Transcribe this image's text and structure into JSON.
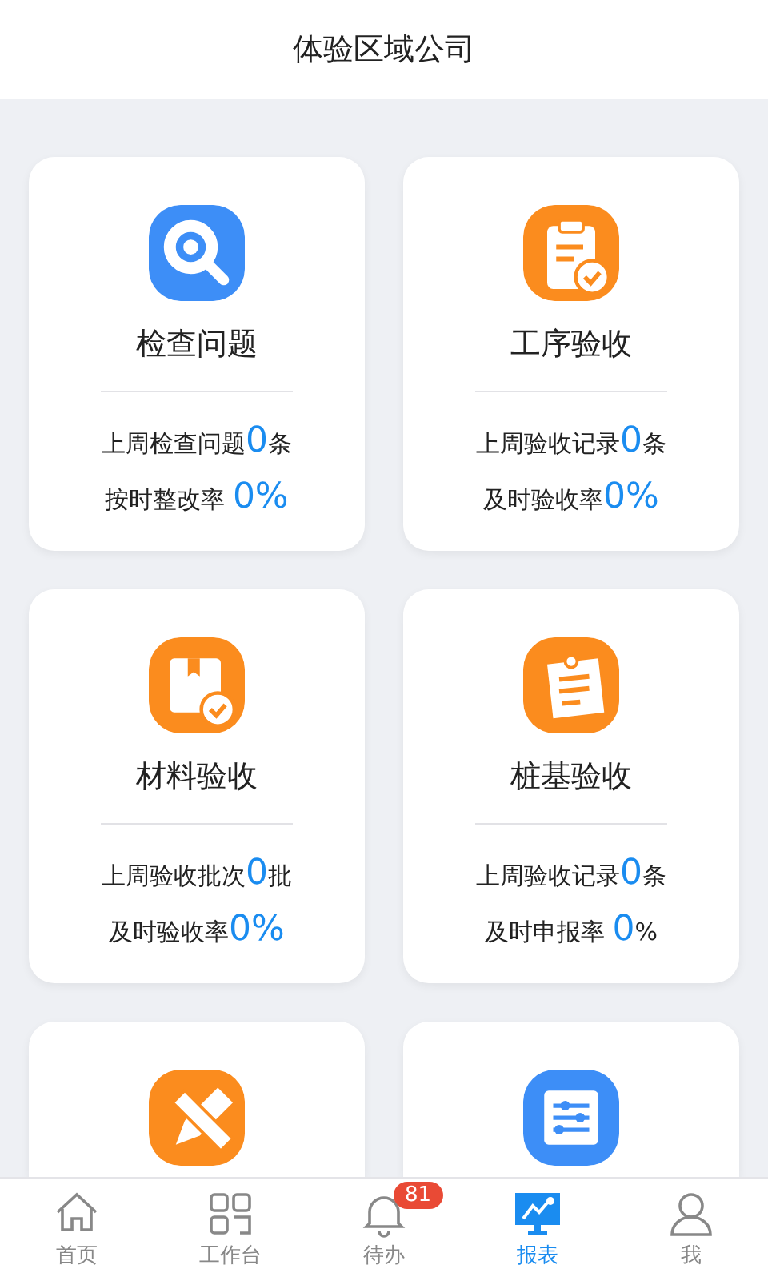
{
  "header": {
    "title": "体验区域公司"
  },
  "cards": [
    {
      "title": "检查问题",
      "kind": "search",
      "color": "#3d8ef7",
      "stats": [
        [
          {
            "kind": "label",
            "text": "上周检查问题"
          },
          {
            "kind": "number",
            "text": "0"
          },
          {
            "kind": "label",
            "text": "条"
          }
        ],
        [
          {
            "kind": "label",
            "text": "按时整改率 "
          },
          {
            "kind": "number",
            "text": "0%"
          }
        ]
      ]
    },
    {
      "title": "工序验收",
      "kind": "clipboard",
      "color": "#fb8c1e",
      "stats": [
        [
          {
            "kind": "label",
            "text": "上周验收记录"
          },
          {
            "kind": "number",
            "text": "0"
          },
          {
            "kind": "label",
            "text": "条"
          }
        ],
        [
          {
            "kind": "label",
            "text": "及时验收率"
          },
          {
            "kind": "number",
            "text": "0%"
          }
        ]
      ]
    },
    {
      "title": "材料验收",
      "kind": "package",
      "color": "#fb8c1e",
      "stats": [
        [
          {
            "kind": "label",
            "text": "上周验收批次"
          },
          {
            "kind": "number",
            "text": "0"
          },
          {
            "kind": "label",
            "text": "批"
          }
        ],
        [
          {
            "kind": "label",
            "text": "及时验收率"
          },
          {
            "kind": "number",
            "text": "0%"
          }
        ]
      ]
    },
    {
      "title": "桩基验收",
      "kind": "note",
      "color": "#fb8c1e",
      "stats": [
        [
          {
            "kind": "label",
            "text": "上周验收记录"
          },
          {
            "kind": "number",
            "text": "0"
          },
          {
            "kind": "label",
            "text": "条"
          }
        ],
        [
          {
            "kind": "label",
            "text": "及时申报率 "
          },
          {
            "kind": "number",
            "text": "0"
          },
          {
            "kind": "label",
            "text": "%"
          }
        ]
      ]
    },
    {
      "kind": "tools",
      "color": "#fb8c1e"
    },
    {
      "kind": "list",
      "color": "#3d8ef7"
    }
  ],
  "tab_bar": {
    "items": [
      {
        "label": "首页",
        "kind": "home",
        "selected": false
      },
      {
        "label": "工作台",
        "kind": "grid",
        "selected": false
      },
      {
        "label": "待办",
        "kind": "bell",
        "selected": false,
        "badge": "81"
      },
      {
        "label": "报表",
        "kind": "chart",
        "selected": true
      },
      {
        "label": "我",
        "kind": "person",
        "selected": false
      }
    ]
  }
}
